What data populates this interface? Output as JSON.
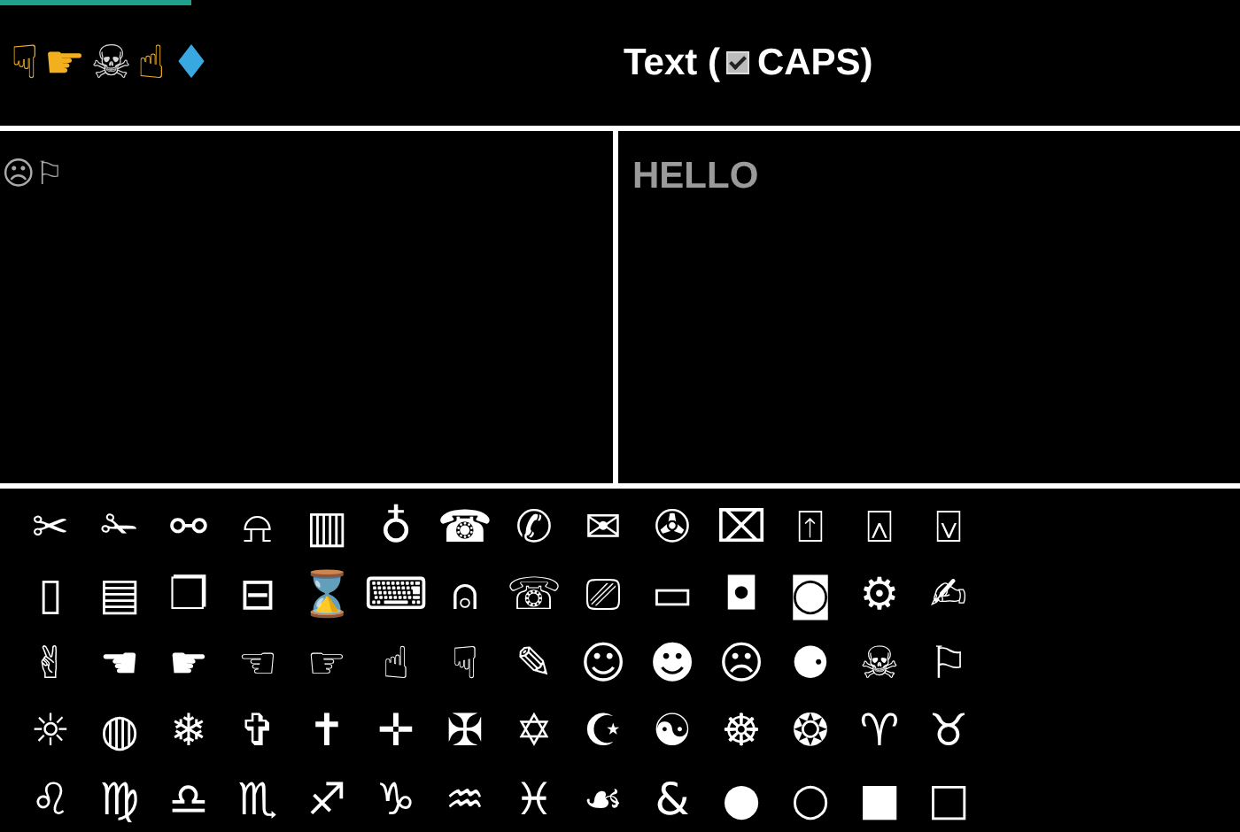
{
  "preview": {
    "glyphs": [
      {
        "char": "☟",
        "color": "#f2b01e"
      },
      {
        "char": "☛",
        "color": "#f2b01e"
      },
      {
        "char": "☠",
        "color": "#d8d8d8"
      },
      {
        "char": "☝",
        "color": "#f2b01e"
      },
      {
        "char": "♦",
        "color": "#3aa8e0"
      }
    ]
  },
  "text_header": {
    "label": "Text (",
    "caps_checked": true,
    "caps_label": "CAPS)"
  },
  "output_panel": {
    "text": "☹⚐"
  },
  "input_panel": {
    "value": "HELLO"
  },
  "keyboard": {
    "rows": [
      [
        "✂",
        "✁",
        "⚯",
        "⍾",
        "▥",
        "♁",
        "☎",
        "✆",
        "✉",
        "✇",
        "⌧",
        "⍐",
        "⍓",
        "⍌"
      ],
      [
        "▯",
        "▤",
        "❐",
        "⊟",
        "⌛",
        "⌨",
        "⍝",
        "☏",
        "⎚",
        "▭",
        "◘",
        "◙",
        "⚙",
        "✍"
      ],
      [
        "✌",
        "☚",
        "☛",
        "☜",
        "☞",
        "☝",
        "☟",
        "✎",
        "☺",
        "☻",
        "☹",
        "⚈",
        "☠",
        "⚐"
      ],
      [
        "☼",
        "◍",
        "❄",
        "✞",
        "✝",
        "✛",
        "✠",
        "✡",
        "☪",
        "☯",
        "☸",
        "❂",
        "♈",
        "♉"
      ],
      [
        "♌",
        "♍",
        "♎",
        "♏",
        "♐",
        "♑",
        "♒",
        "♓",
        "☙",
        "&",
        "●",
        "○",
        "■",
        "□"
      ]
    ]
  }
}
